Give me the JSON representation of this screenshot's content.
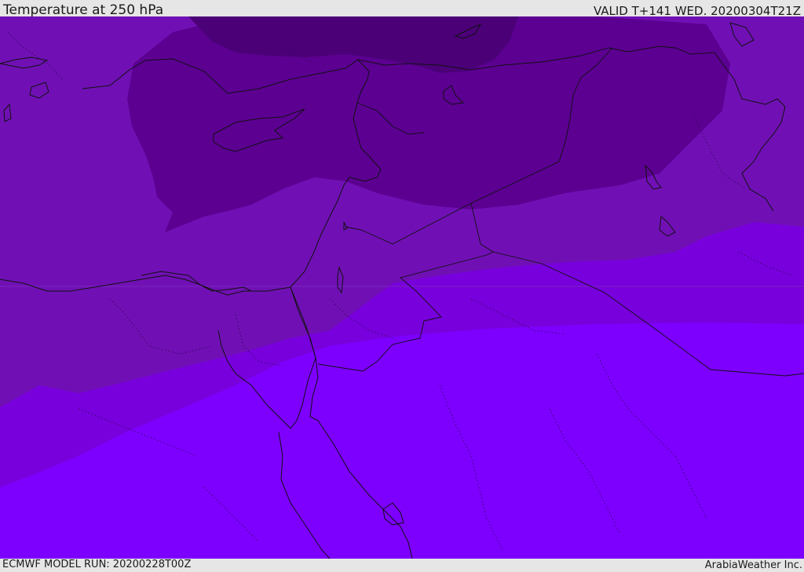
{
  "header": {
    "title": "Temperature at 250 hPa",
    "valid": "VALID T+141 WED. 20200304T21Z"
  },
  "footer": {
    "model_run": "ECMWF MODEL RUN: 20200228T00Z",
    "credit": "ArabiaWeather Inc."
  },
  "colors": {
    "band_coldest": "#4b0078",
    "band_cold": "#5c0092",
    "band_mid": "#7010b4",
    "band_warm": "#7800dc",
    "band_warmest": "#7d00ff",
    "coastline": "#111111"
  }
}
